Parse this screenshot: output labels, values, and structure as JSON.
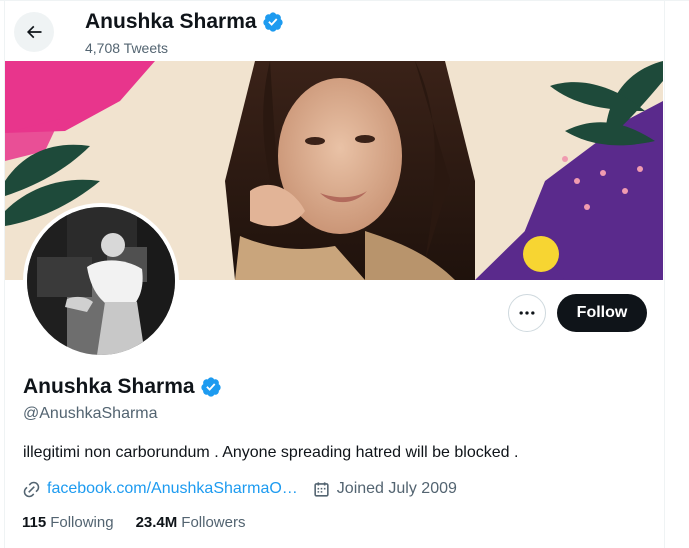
{
  "header": {
    "back_icon": "arrow-left-icon",
    "name": "Anushka Sharma",
    "tweet_count": "4,708 Tweets"
  },
  "profile": {
    "name": "Anushka Sharma",
    "handle": "@AnushkaSharma",
    "bio": "illegitimi non carborundum . Anyone spreading hatred will be blocked .",
    "website": "facebook.com/AnushkaSharmaO…",
    "joined": "Joined July 2009",
    "verified_icon": "verified-badge-icon"
  },
  "actions": {
    "more_icon": "more-horizontal-icon",
    "follow_label": "Follow"
  },
  "stats": {
    "following_count": "115",
    "following_label": "Following",
    "followers_count": "23.4M",
    "followers_label": "Followers"
  },
  "colors": {
    "accent": "#1d9bf0",
    "text_primary": "#0f1419",
    "text_secondary": "#536471",
    "follow_bg": "#0f1419",
    "banner_pink": "#e8358c",
    "banner_purple": "#5a2a8c",
    "banner_yellow": "#f7d532",
    "banner_green": "#1e4a3a"
  }
}
